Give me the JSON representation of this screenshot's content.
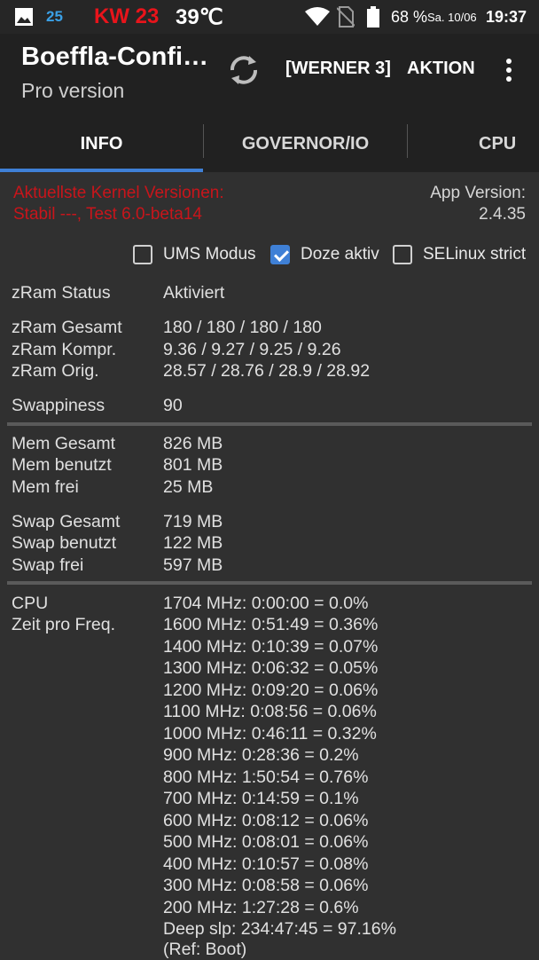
{
  "statusbar": {
    "badge_25": "25",
    "kw": "KW 23",
    "temp": "39℃",
    "battery_pct": "68 %",
    "date": "Sa. 10/06",
    "time": "19:37"
  },
  "appbar": {
    "title": "Boeffla-Confi…",
    "subtitle": "Pro version",
    "werner": "[WERNER 3]",
    "aktion": "AKTION"
  },
  "tabs": [
    "INFO",
    "GOVERNOR/IO",
    "CPU"
  ],
  "info": {
    "kernel_line1": "Aktuellste Kernel Versionen:",
    "kernel_line2": "Stabil ---, Test 6.0-beta14",
    "appver_label": "App Version:",
    "appver_value": "2.4.35"
  },
  "checks": {
    "ums": {
      "label": "UMS Modus",
      "checked": false
    },
    "doze": {
      "label": "Doze aktiv",
      "checked": true
    },
    "selinux": {
      "label": "SELinux strict",
      "checked": false
    }
  },
  "zram": {
    "status_label": "zRam Status",
    "status_value": "Aktiviert",
    "gesamt_label": "zRam Gesamt",
    "gesamt_value": "180 / 180 / 180 / 180",
    "kompr_label": "zRam Kompr.",
    "kompr_value": "9.36 / 9.27 / 9.25 / 9.26",
    "orig_label": "zRam Orig.",
    "orig_value": "28.57 / 28.76 / 28.9 / 28.92",
    "swappiness_label": "Swappiness",
    "swappiness_value": "90"
  },
  "memory": {
    "mem_gesamt_label": "Mem Gesamt",
    "mem_gesamt_value": "826 MB",
    "mem_benutzt_label": "Mem benutzt",
    "mem_benutzt_value": "801 MB",
    "mem_frei_label": "Mem frei",
    "mem_frei_value": "25 MB",
    "swap_gesamt_label": "Swap Gesamt",
    "swap_gesamt_value": "719 MB",
    "swap_benutzt_label": "Swap benutzt",
    "swap_benutzt_value": "122 MB",
    "swap_frei_label": "Swap frei",
    "swap_frei_value": "597 MB"
  },
  "cpu": {
    "label1": "CPU",
    "label2": "Zeit pro Freq.",
    "freqs": [
      "1704 MHz: 0:00:00 = 0.0%",
      "1600 MHz: 0:51:49 = 0.36%",
      "1400 MHz: 0:10:39 = 0.07%",
      "1300 MHz: 0:06:32 = 0.05%",
      "1200 MHz: 0:09:20 = 0.06%",
      "1100 MHz: 0:08:56 = 0.06%",
      "1000 MHz: 0:46:11 = 0.32%",
      "900 MHz: 0:28:36 = 0.2%",
      "800 MHz: 1:50:54 = 0.76%",
      "700 MHz: 0:14:59 = 0.1%",
      "600 MHz: 0:08:12 = 0.06%",
      "500 MHz: 0:08:01 = 0.06%",
      "400 MHz: 0:10:57 = 0.08%",
      "300 MHz: 0:08:58 = 0.06%",
      "200 MHz: 1:27:28 = 0.6%",
      "Deep slp: 234:47:45 = 97.16%",
      "(Ref: Boot)"
    ]
  }
}
